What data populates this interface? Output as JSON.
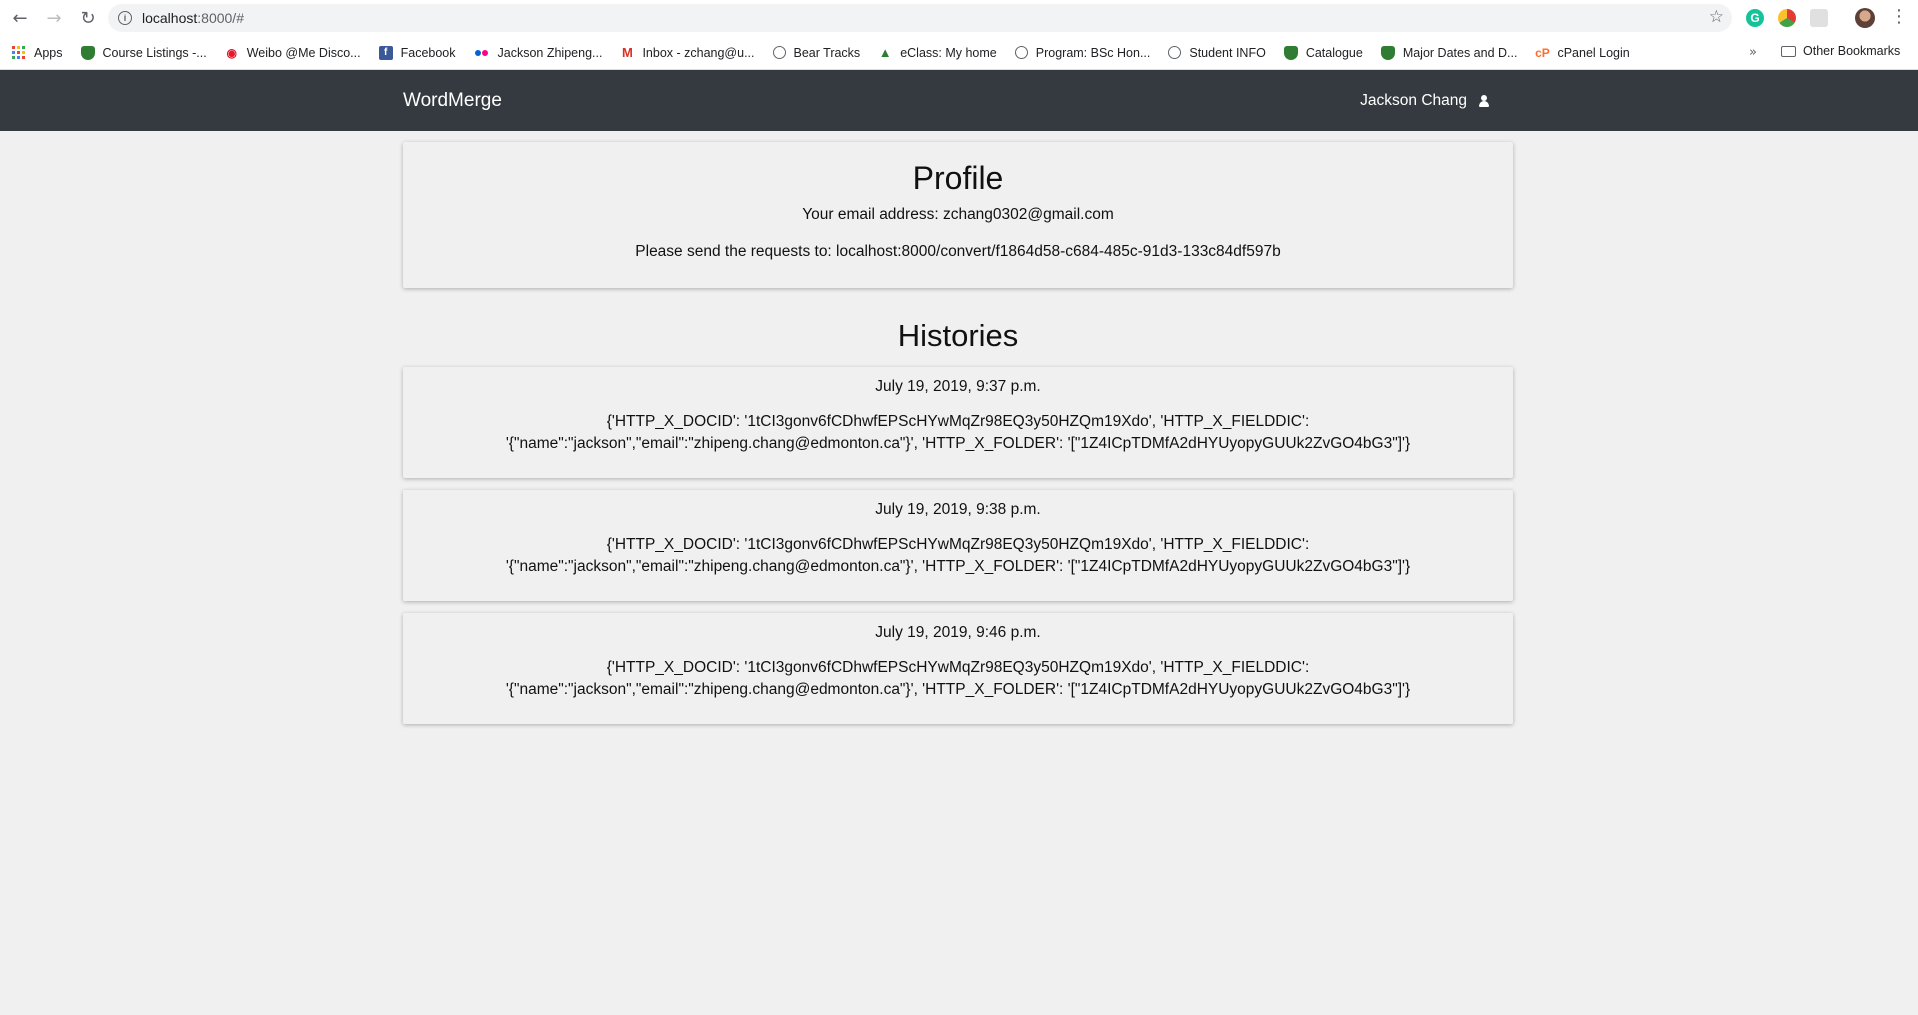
{
  "browser": {
    "url_host": "localhost",
    "url_path": ":8000/#",
    "bookmarks": [
      {
        "label": "Apps",
        "icon": "apps-icon"
      },
      {
        "label": "Course Listings -...",
        "icon": "shield-icon"
      },
      {
        "label": "Weibo @Me Disco...",
        "icon": "weibo-icon"
      },
      {
        "label": "Facebook",
        "icon": "facebook-icon"
      },
      {
        "label": "Jackson Zhipeng...",
        "icon": "flickr-icon"
      },
      {
        "label": "Inbox - zchang@u...",
        "icon": "gmail-icon"
      },
      {
        "label": "Bear Tracks",
        "icon": "globe-icon"
      },
      {
        "label": "eClass: My home",
        "icon": "graduation-cap-icon"
      },
      {
        "label": "Program: BSc Hon...",
        "icon": "globe-icon"
      },
      {
        "label": "Student INFO",
        "icon": "globe-icon"
      },
      {
        "label": "Catalogue",
        "icon": "shield-icon"
      },
      {
        "label": "Major Dates and D...",
        "icon": "shield-icon"
      },
      {
        "label": "cPanel Login",
        "icon": "cpanel-icon"
      }
    ],
    "more_label": "»",
    "other_bookmarks": "Other Bookmarks"
  },
  "app": {
    "brand": "WordMerge",
    "user_name": "Jackson Chang"
  },
  "profile": {
    "title": "Profile",
    "email_line": "Your email address: zchang0302@gmail.com",
    "request_line": "Please send the requests to: localhost:8000/convert/f1864d58-c684-485c-91d3-133c84df597b"
  },
  "histories": {
    "title": "Histories",
    "items": [
      {
        "timestamp": "July 19, 2019, 9:37 p.m.",
        "body": "{'HTTP_X_DOCID': '1tCI3gonv6fCDhwfEPScHYwMqZr98EQ3y50HZQm19Xdo', 'HTTP_X_FIELDDIC': '{\"name\":\"jackson\",\"email\":\"zhipeng.chang@edmonton.ca\"}', 'HTTP_X_FOLDER': '[\"1Z4ICpTDMfA2dHYUyopyGUUk2ZvGO4bG3\"]'}"
      },
      {
        "timestamp": "July 19, 2019, 9:38 p.m.",
        "body": "{'HTTP_X_DOCID': '1tCI3gonv6fCDhwfEPScHYwMqZr98EQ3y50HZQm19Xdo', 'HTTP_X_FIELDDIC': '{\"name\":\"jackson\",\"email\":\"zhipeng.chang@edmonton.ca\"}', 'HTTP_X_FOLDER': '[\"1Z4ICpTDMfA2dHYUyopyGUUk2ZvGO4bG3\"]'}"
      },
      {
        "timestamp": "July 19, 2019, 9:46 p.m.",
        "body": "{'HTTP_X_DOCID': '1tCI3gonv6fCDhwfEPScHYwMqZr98EQ3y50HZQm19Xdo', 'HTTP_X_FIELDDIC': '{\"name\":\"jackson\",\"email\":\"zhipeng.chang@edmonton.ca\"}', 'HTTP_X_FOLDER': '[\"1Z4ICpTDMfA2dHYUyopyGUUk2ZvGO4bG3\"]'}"
      }
    ]
  },
  "colors": {
    "navbar": "#343a40",
    "page_bg": "#f0f0f0"
  }
}
